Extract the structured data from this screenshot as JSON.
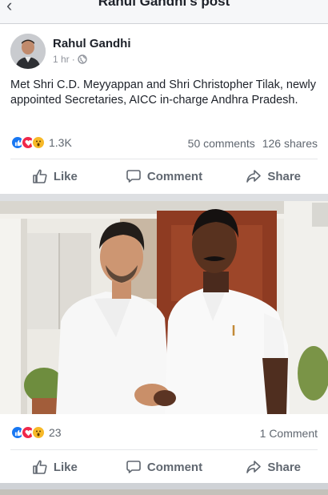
{
  "header": {
    "title": "Rahul Gandhi's post"
  },
  "post": {
    "author": "Rahul Gandhi",
    "time": "1 hr",
    "separator": "·",
    "text": "Met Shri C.D. Meyyappan and Shri Christopher Tilak, newly appointed Secretaries, AICC in-charge Andhra Pradesh.",
    "reactions_count": "1.3K",
    "comments": "50 comments",
    "shares": "126 shares"
  },
  "actions": {
    "like": "Like",
    "comment": "Comment",
    "share": "Share"
  },
  "photo_post": {
    "reactions_count": "23",
    "comments": "1 Comment"
  },
  "icons": {
    "reactions": [
      "like-icon",
      "love-icon",
      "wow-icon"
    ],
    "privacy": "globe-icon"
  },
  "colors": {
    "like": "#1877f2",
    "love": "#f0284a",
    "wow": "#f7b928",
    "text_secondary": "#606770"
  }
}
